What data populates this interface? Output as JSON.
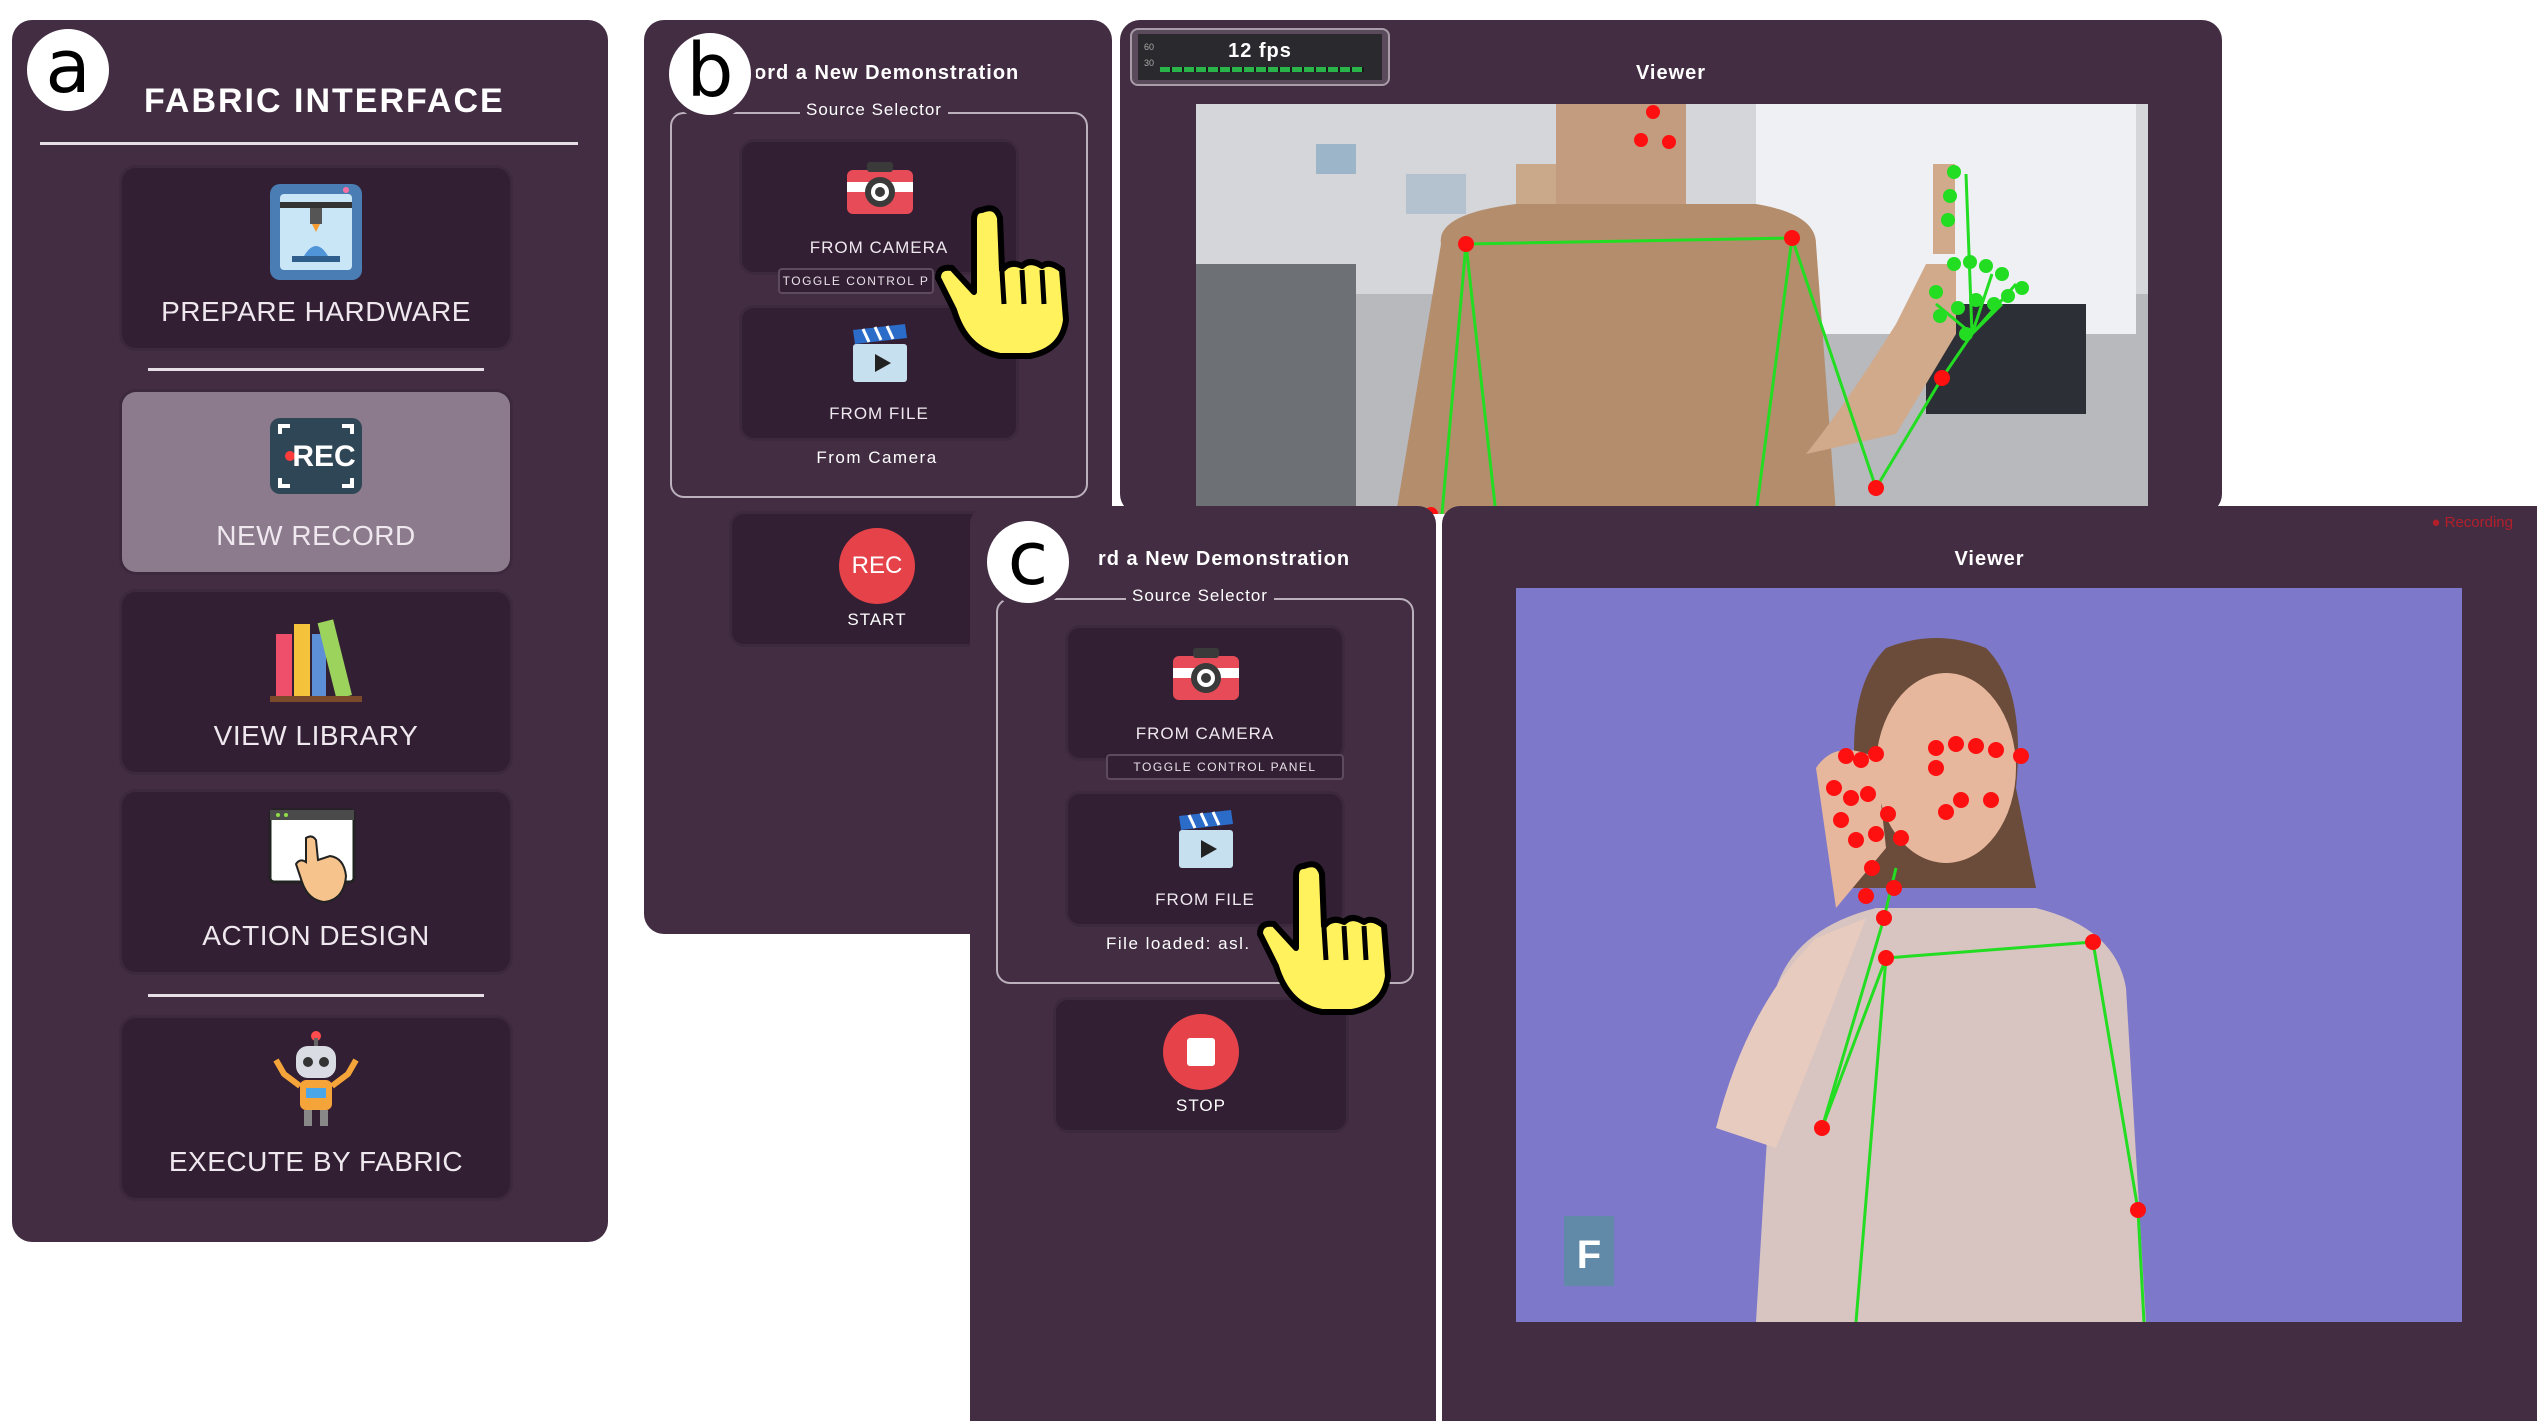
{
  "labels": {
    "a": "a",
    "b": "b",
    "c": "c"
  },
  "panel_a": {
    "title": "FABRIC INTERFACE",
    "items": [
      {
        "label": "PREPARE HARDWARE",
        "icon": "3d-printer-icon",
        "active": false
      },
      {
        "label": "NEW RECORD",
        "icon": "rec-icon",
        "icon_text": "REC",
        "active": true
      },
      {
        "label": "VIEW LIBRARY",
        "icon": "books-icon",
        "active": false
      },
      {
        "label": "ACTION DESIGN",
        "icon": "touch-screen-icon",
        "active": false
      },
      {
        "label": "EXECUTE BY FABRIC",
        "icon": "robot-icon",
        "active": false
      }
    ]
  },
  "panel_b": {
    "title": "ord a New Demonstration",
    "source_selector": "Source Selector",
    "from_camera": "FROM CAMERA",
    "toggle_control_panel": "TOGGLE CONTROL P",
    "from_file": "FROM FILE",
    "status": "From Camera",
    "rec_button": "REC",
    "start": "START",
    "fps": "12 fps",
    "fps_scale_top": "60",
    "fps_scale_bottom": "30",
    "viewer_title": "Viewer"
  },
  "panel_c": {
    "title": "rd a New Demonstration",
    "source_selector": "Source Selector",
    "from_camera": "FROM CAMERA",
    "toggle_control_panel": "TOGGLE CONTROL PANEL",
    "from_file": "FROM FILE",
    "status": "File loaded: asl.",
    "stop": "STOP",
    "viewer_title": "Viewer",
    "recording": "● Recording",
    "watermark": "F"
  },
  "colors": {
    "panel_bg": "#432d43",
    "card_bg": "#321f33",
    "active_card": "#8c7b8d",
    "rec_red": "#e64249",
    "landmark_red": "#ff0000",
    "landmark_green": "#22dd22"
  }
}
